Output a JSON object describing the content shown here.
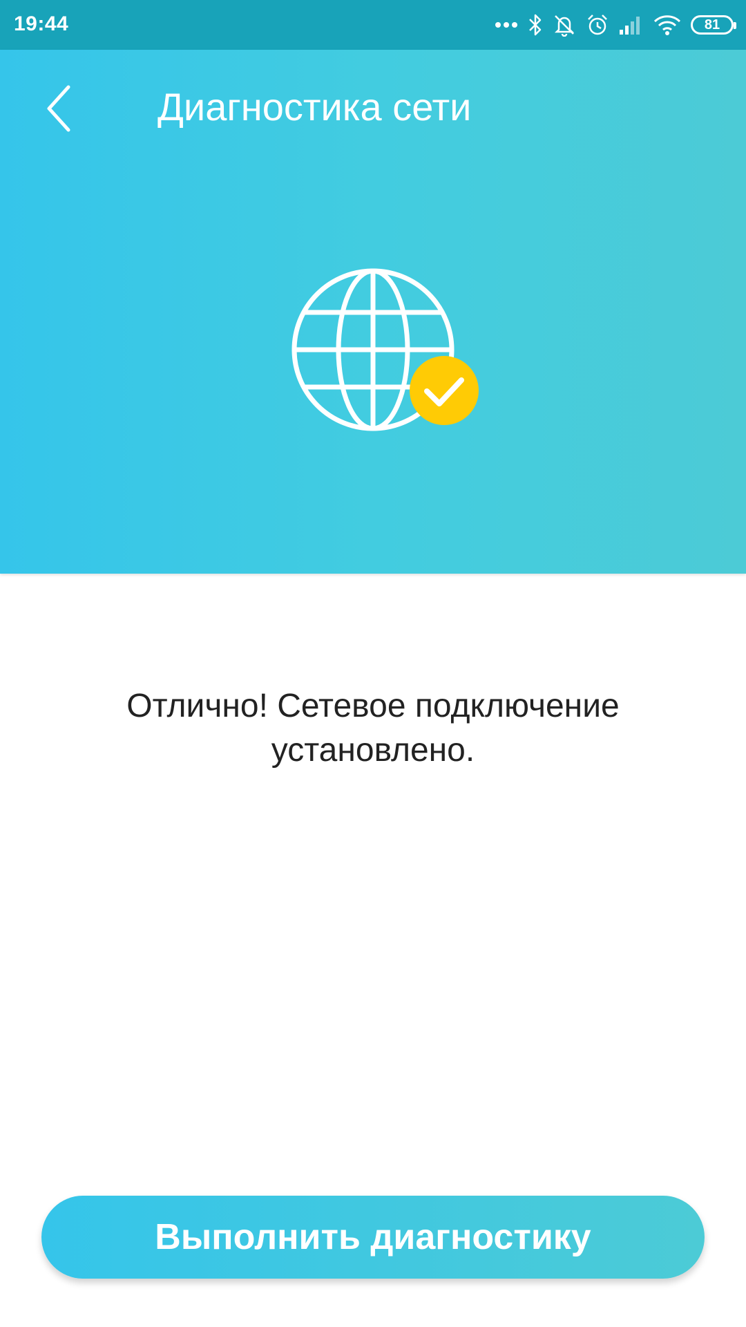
{
  "status_bar": {
    "time": "19:44",
    "battery_level": "81",
    "icons": [
      "more-dots-icon",
      "bluetooth-icon",
      "bell-muted-icon",
      "alarm-icon",
      "cellular-signal-icon",
      "wifi-icon",
      "battery-icon"
    ]
  },
  "header": {
    "title": "Диагностика сети",
    "back_icon": "chevron-left-icon",
    "illustration_icon": "globe-check-icon",
    "gradient_start": "#35c5ea",
    "gradient_end": "#4ccbd6",
    "badge_color": "#ffcb05"
  },
  "main": {
    "message": "Отлично! Сетевое подключение установлено."
  },
  "footer": {
    "run_button_label": "Выполнить диагностику"
  }
}
